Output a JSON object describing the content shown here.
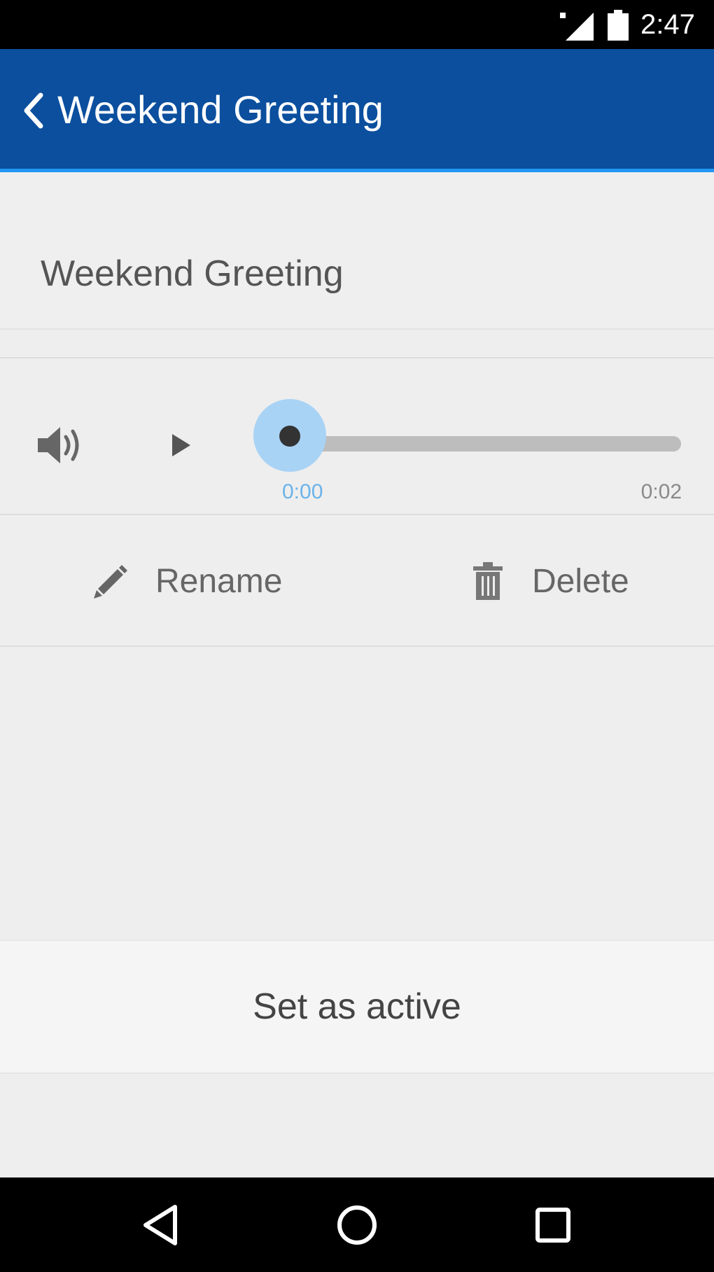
{
  "status_bar": {
    "time": "2:47",
    "icons": [
      "cell-signal-icon",
      "battery-icon"
    ]
  },
  "app_bar": {
    "back_icon": "chevron-left-icon",
    "title": "Weekend Greeting",
    "color": "#0b4f9e",
    "accent": "#2196f3"
  },
  "greeting": {
    "name": "Weekend Greeting"
  },
  "player": {
    "volume_icon": "volume-icon",
    "play_icon": "play-icon",
    "current_time": "0:00",
    "total_time": "0:02",
    "progress": 0
  },
  "actions": {
    "rename_label": "Rename",
    "rename_icon": "pencil-icon",
    "delete_label": "Delete",
    "delete_icon": "trash-icon"
  },
  "primary_action": {
    "label": "Set as active"
  },
  "nav_bar": {
    "icons": [
      "back-triangle-icon",
      "home-circle-icon",
      "recents-square-icon"
    ]
  }
}
